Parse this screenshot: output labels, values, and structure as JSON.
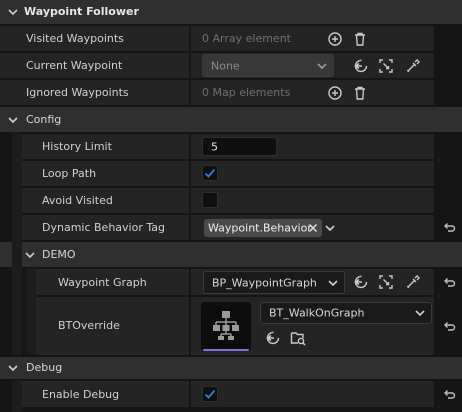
{
  "waypoint_follower": {
    "title": "Waypoint Follower",
    "visited_waypoints": {
      "label": "Visited Waypoints",
      "value": "0 Array element"
    },
    "current_waypoint": {
      "label": "Current Waypoint",
      "value": "None"
    },
    "ignored_waypoints": {
      "label": "Ignored Waypoints",
      "value": "0 Map elements"
    }
  },
  "config": {
    "title": "Config",
    "history_limit": {
      "label": "History Limit",
      "value": "5"
    },
    "loop_path": {
      "label": "Loop Path",
      "checked": true
    },
    "avoid_visited": {
      "label": "Avoid Visited",
      "checked": false
    },
    "dynamic_behavior_tag": {
      "label": "Dynamic Behavior Tag",
      "value": "Waypoint.Behavior"
    },
    "demo": {
      "title": "DEMO",
      "waypoint_graph": {
        "label": "Waypoint Graph",
        "value": "BP_WaypointGraph"
      },
      "bt_override": {
        "label": "BTOverride",
        "value": "BT_WalkOnGraph"
      }
    }
  },
  "debug": {
    "title": "Debug",
    "enable_debug": {
      "label": "Enable Debug",
      "checked": true
    }
  },
  "colors": {
    "accent_blue": "#2f7de0",
    "thumbnail_bar": "#8a6cd6",
    "panel_bg": "#242424",
    "category_bg": "#2f2f2f"
  },
  "icons": [
    "chevron-down-icon",
    "add-icon",
    "trash-icon",
    "use-selected-icon",
    "browse-icon",
    "eyedropper-icon",
    "reset-icon",
    "clear-icon",
    "behavior-tree-icon",
    "find-in-browser-icon"
  ]
}
